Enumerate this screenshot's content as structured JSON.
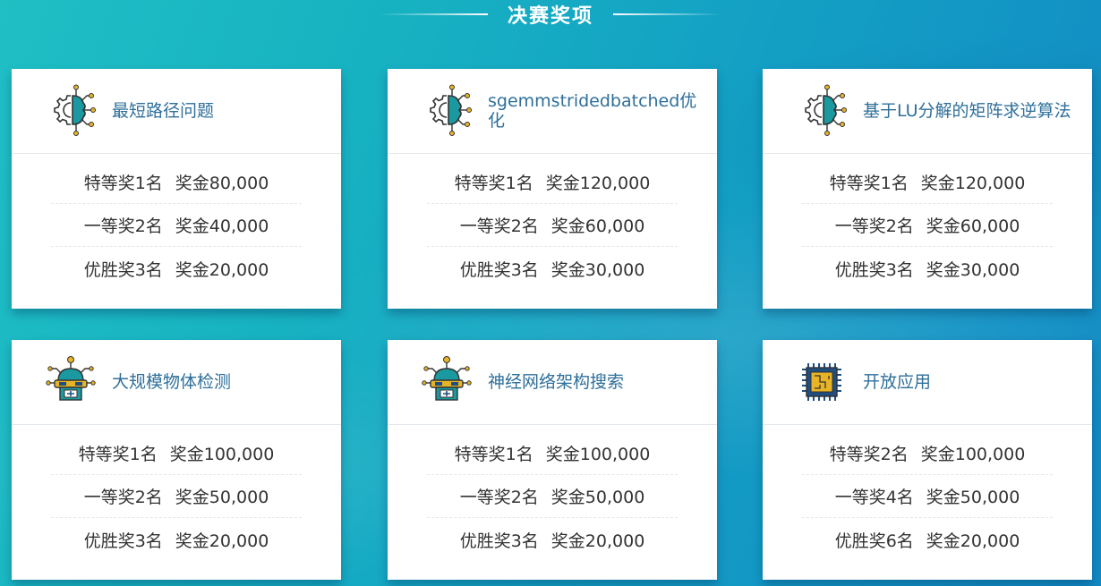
{
  "section": {
    "title": "决赛奖项"
  },
  "cards": [
    {
      "title": "最短路径问题",
      "icon": "brain-gear-icon",
      "prizes": [
        {
          "level": "特等奖1名",
          "amount": "奖金80,000"
        },
        {
          "level": "一等奖2名",
          "amount": "奖金40,000"
        },
        {
          "level": "优胜奖3名",
          "amount": "奖金20,000"
        }
      ]
    },
    {
      "title": "sgemmstridedbatched优化",
      "icon": "brain-gear-icon",
      "prizes": [
        {
          "level": "特等奖1名",
          "amount": "奖金120,000"
        },
        {
          "level": "一等奖2名",
          "amount": "奖金60,000"
        },
        {
          "level": "优胜奖3名",
          "amount": "奖金30,000"
        }
      ]
    },
    {
      "title": "基于LU分解的矩阵求逆算法",
      "icon": "brain-gear-icon",
      "prizes": [
        {
          "level": "特等奖1名",
          "amount": "奖金120,000"
        },
        {
          "level": "一等奖2名",
          "amount": "奖金60,000"
        },
        {
          "level": "优胜奖3名",
          "amount": "奖金30,000"
        }
      ]
    },
    {
      "title": "大规模物体检测",
      "icon": "robot-icon",
      "prizes": [
        {
          "level": "特等奖1名",
          "amount": "奖金100,000"
        },
        {
          "level": "一等奖2名",
          "amount": "奖金50,000"
        },
        {
          "level": "优胜奖3名",
          "amount": "奖金20,000"
        }
      ]
    },
    {
      "title": "神经网络架构搜索",
      "icon": "robot-icon",
      "prizes": [
        {
          "level": "特等奖1名",
          "amount": "奖金100,000"
        },
        {
          "level": "一等奖2名",
          "amount": "奖金50,000"
        },
        {
          "level": "优胜奖3名",
          "amount": "奖金20,000"
        }
      ]
    },
    {
      "title": "开放应用",
      "icon": "chip-icon",
      "prizes": [
        {
          "level": "特等奖2名",
          "amount": "奖金100,000"
        },
        {
          "level": "一等奖4名",
          "amount": "奖金50,000"
        },
        {
          "level": "优胜奖6名",
          "amount": "奖金20,000"
        }
      ]
    }
  ],
  "colors": {
    "title_text": "#2f6f9a",
    "prize_text": "#333333",
    "icon_teal": "#1a9aa0",
    "icon_gold": "#e8b427",
    "icon_navy": "#1e4f80"
  }
}
